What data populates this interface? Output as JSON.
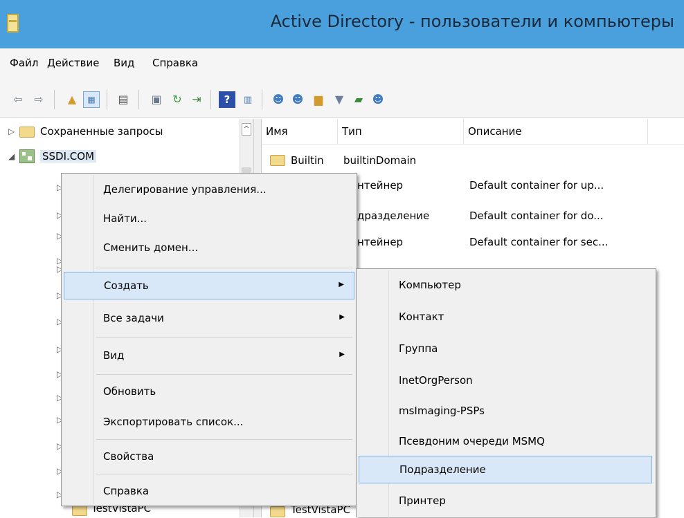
{
  "window": {
    "title": "Active Directory - пользователи и компьютеры"
  },
  "menu": [
    "Файл",
    "Действие",
    "Вид",
    "Справка"
  ],
  "tree": {
    "saved_queries": "Сохраненные запросы",
    "domain": "SSDI.COM",
    "bottom_item": "TestVistaPC"
  },
  "list": {
    "columns": [
      "Имя",
      "Тип",
      "Описание"
    ],
    "rows": [
      {
        "name": "Builtin",
        "type": "builtinDomain",
        "desc": ""
      },
      {
        "name": "",
        "type": "нтейнер",
        "desc": "Default container for up..."
      },
      {
        "name": "",
        "type": "дразделение",
        "desc": "Default container for do..."
      },
      {
        "name": "",
        "type": "нтейнер",
        "desc": "Default container for sec..."
      }
    ],
    "bottom_item": "TestVistaPC"
  },
  "context_menu": {
    "delegate": "Делегирование управления...",
    "find": "Найти...",
    "change_domain": "Сменить домен...",
    "create": "Создать",
    "all_tasks": "Все задачи",
    "view": "Вид",
    "refresh": "Обновить",
    "export": "Экспортировать список...",
    "properties": "Свойства",
    "help": "Справка",
    "submenu_arrow": "▶"
  },
  "submenu": {
    "items": [
      "Компьютер",
      "Контакт",
      "Группа",
      "InetOrgPerson",
      "msImaging-PSPs",
      "Псевдоним очереди MSMQ",
      "Подразделение",
      "Принтер"
    ]
  },
  "colors": {
    "titlebar": "#4a9fdd",
    "highlight": "#d9e8f8",
    "highlight_border": "#7fb1e4"
  }
}
